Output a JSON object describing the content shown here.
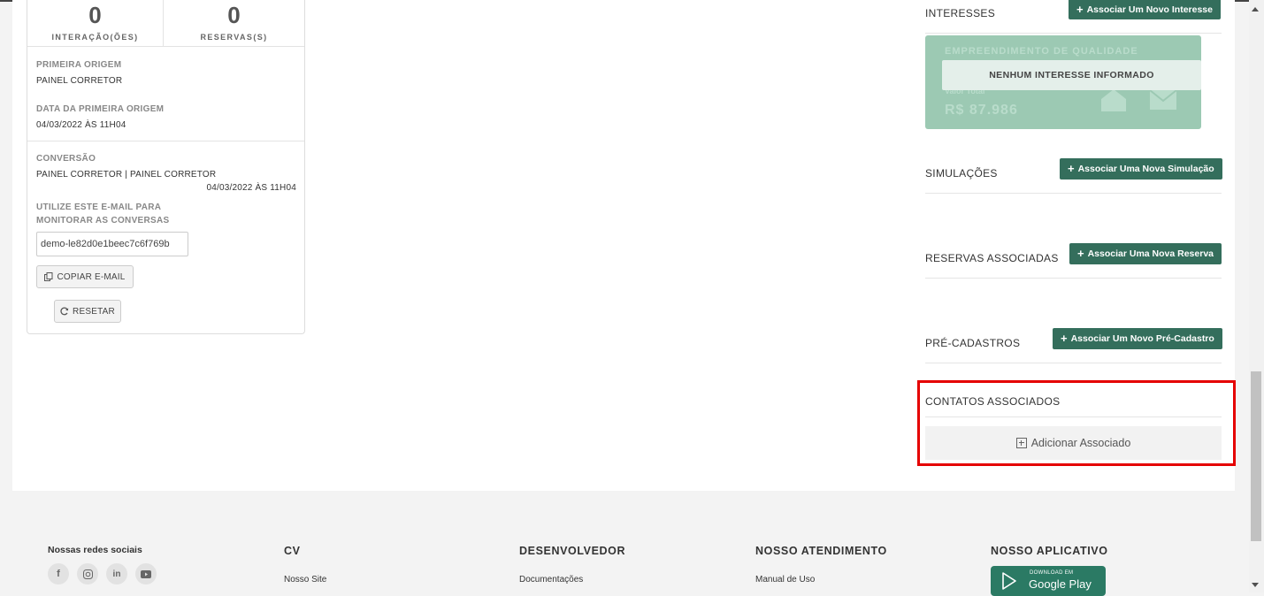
{
  "left_panel": {
    "stats": [
      {
        "number": "0",
        "label": "INTERAÇÃO(ÕES)"
      },
      {
        "number": "0",
        "label": "RESERVAS(S)"
      }
    ],
    "first_origin_label": "PRIMEIRA ORIGEM",
    "first_origin_value": "PAINEL CORRETOR",
    "first_origin_date_label": "DATA DA PRIMEIRA ORIGEM",
    "first_origin_date_value": "04/03/2022 ÀS 11H04",
    "conversion_label": "CONVERSÃO",
    "conversion_value": "PAINEL CORRETOR | PAINEL CORRETOR",
    "conversion_date": "04/03/2022 ÀS 11H04",
    "email_hint_line1": "UTILIZE ESTE E-MAIL PARA",
    "email_hint_line2": "MONITORAR AS CONVERSAS",
    "email_value": "demo-le82d0e1beec7c6f769b",
    "copy_button": "COPIAR E-MAIL",
    "reset_button": "RESETAR"
  },
  "right_column": {
    "interests": {
      "title": "INTERESSES",
      "button": "Associar Um Novo Interesse",
      "empty_text": "NENHUM INTERESSE INFORMADO",
      "ghost_title": "EMPREENDIMENTO DE QUALIDADE",
      "ghost_label": "Valor Total",
      "ghost_value": "R$ 87.986"
    },
    "simulations": {
      "title": "SIMULAÇÕES",
      "button": "Associar Uma Nova Simulação"
    },
    "reservations": {
      "title": "RESERVAS ASSOCIADAS",
      "button": "Associar Uma Nova Reserva"
    },
    "pre_registrations": {
      "title": "PRÉ-CADASTROS",
      "button": "Associar Um Novo Pré-Cadastro"
    },
    "contacts": {
      "title": "CONTATOS ASSOCIADOS",
      "add_button": "Adicionar Associado"
    }
  },
  "footer": {
    "social_title": "Nossas redes sociais",
    "social_icons": [
      "facebook-icon",
      "instagram-icon",
      "linkedin-icon",
      "youtube-icon"
    ],
    "columns": [
      {
        "title": "CV",
        "link": "Nosso Site"
      },
      {
        "title": "DESENVOLVEDOR",
        "link": "Documentações"
      },
      {
        "title": "NOSSO ATENDIMENTO",
        "link": "Manual de Uso"
      },
      {
        "title": "NOSSO APLICATIVO",
        "badge_small": "DOWNLOAD EM",
        "badge_big": "Google Play"
      }
    ]
  },
  "colors": {
    "accent_green": "#346e5c",
    "highlight_red": "#e50000"
  }
}
